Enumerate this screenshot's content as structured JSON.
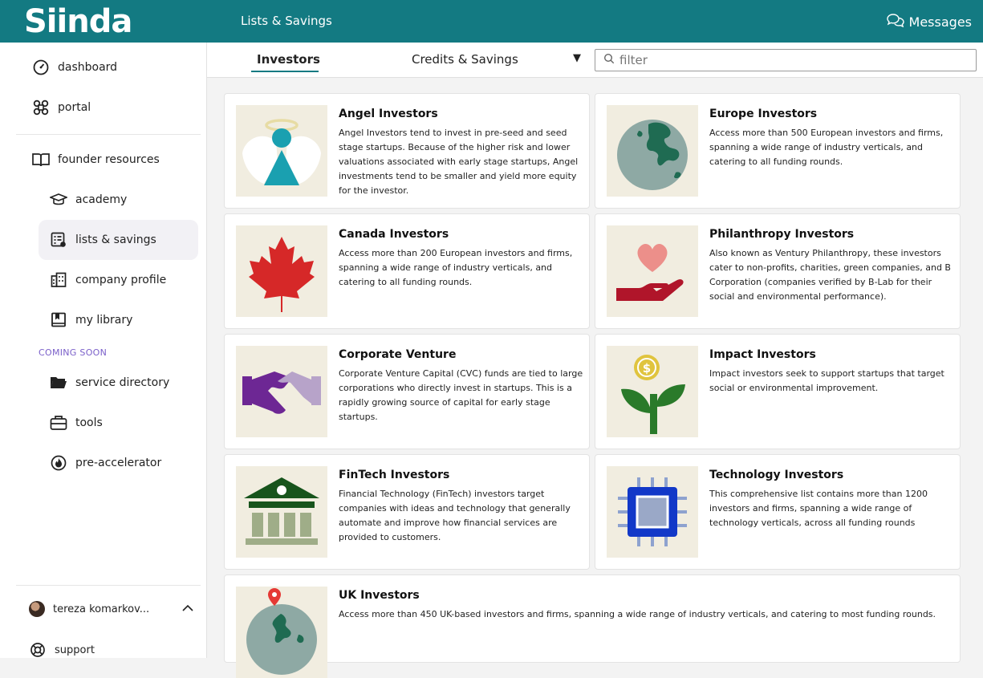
{
  "header": {
    "logo": "Siinda",
    "title": "Lists & Savings",
    "messages_label": "Messages"
  },
  "sidebar": {
    "items": [
      {
        "label": "dashboard",
        "icon": "dashboard-icon"
      },
      {
        "label": "portal",
        "icon": "portal-icon"
      },
      {
        "label": "founder resources",
        "icon": "book-icon"
      },
      {
        "label": "academy",
        "icon": "graduation-cap-icon"
      },
      {
        "label": "lists & savings",
        "icon": "list-icon",
        "active": true
      },
      {
        "label": "company profile",
        "icon": "building-icon"
      },
      {
        "label": "my library",
        "icon": "library-icon"
      }
    ],
    "coming_soon_label": "COMING SOON",
    "coming_items": [
      {
        "label": "service directory",
        "icon": "folder-icon"
      },
      {
        "label": "tools",
        "icon": "toolbox-icon"
      },
      {
        "label": "pre-accelerator",
        "icon": "flame-icon"
      }
    ],
    "user_name": "tereza komarkov...",
    "support_label": "support"
  },
  "tabs": {
    "items": [
      "Investors",
      "Credits & Savings"
    ],
    "active": "Investors",
    "filter_placeholder": "filter"
  },
  "cards": [
    {
      "title": "Angel Investors",
      "desc": "Angel Investors tend to invest in pre-seed and seed stage startups. Because of the higher risk and lower valuations associated with early stage startups, Angel investments tend to be smaller and yield more equity for the investor."
    },
    {
      "title": "Europe Investors",
      "desc": "Access more than 500 European investors and firms, spanning a wide range of industry verticals, and catering to all funding rounds."
    },
    {
      "title": "Canada Investors",
      "desc": "Access more than 200 European investors and firms, spanning a wide range of industry verticals, and catering to all funding rounds."
    },
    {
      "title": "Philanthropy Investors",
      "desc": "Also known as Ventury Philanthropy, these investors cater to non-profits, charities, green companies, and B Corporation (companies verified by B-Lab for their social and environmental performance)."
    },
    {
      "title": "Corporate Venture",
      "desc": "Corporate Venture Capital (CVC) funds are tied to large corporations who directly invest in startups. This is a rapidly growing source of capital for early stage startups."
    },
    {
      "title": "Impact Investors",
      "desc": "Impact investors seek to support startups that target social or environmental improvement."
    },
    {
      "title": "FinTech Investors",
      "desc": "Financial Technology (FinTech) investors target companies with ideas and technology that generally automate and improve how financial services are provided to customers."
    },
    {
      "title": "Technology Investors",
      "desc": "This comprehensive list contains more than 1200 investors and firms, spanning a wide range of technology verticals, across all funding rounds"
    },
    {
      "title": "UK Investors",
      "desc": "Access more than 450 UK-based investors and firms, spanning a wide range of industry verticals, and catering to most funding rounds."
    }
  ],
  "colors": {
    "brand": "#137a82",
    "thumb_bg": "#f1ede0",
    "coming_soon": "#7a5fc9"
  }
}
